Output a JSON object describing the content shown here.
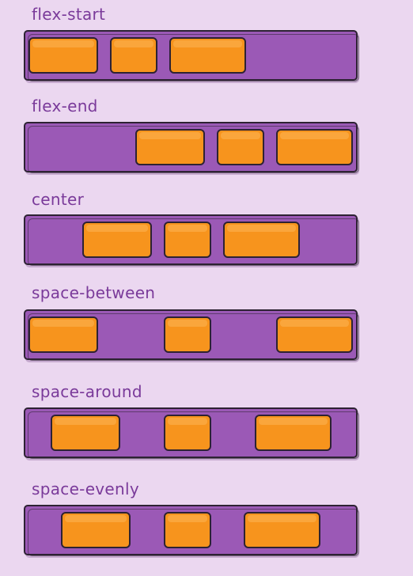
{
  "colors": {
    "background": "#ebd7f0",
    "label_text": "#7a3a9a",
    "container_fill": "#9b59b6",
    "item_fill": "#f7941d",
    "outline": "#2d2233"
  },
  "examples": [
    {
      "label": "flex-start"
    },
    {
      "label": "flex-end"
    },
    {
      "label": "center"
    },
    {
      "label": "space-between"
    },
    {
      "label": "space-around"
    },
    {
      "label": "space-evenly"
    }
  ]
}
